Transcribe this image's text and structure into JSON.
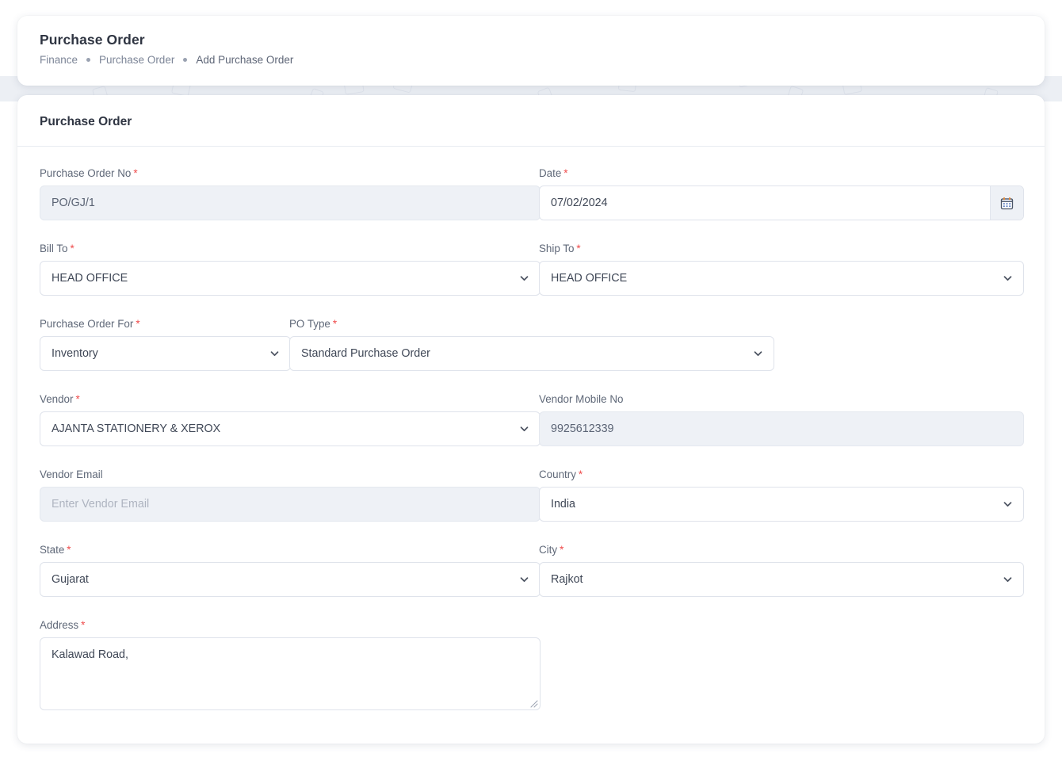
{
  "header": {
    "title": "Purchase Order",
    "breadcrumb": [
      "Finance",
      "Purchase Order",
      "Add Purchase Order"
    ]
  },
  "form_card": {
    "title": "Purchase Order"
  },
  "fields": {
    "purchase_order_no": {
      "label": "Purchase Order No",
      "required": true,
      "value": "PO/GJ/1",
      "state": "disabled"
    },
    "date": {
      "label": "Date",
      "required": true,
      "value": "07/02/2024",
      "icon": "calendar-icon",
      "icon_glyph": "🗓"
    },
    "bill_to": {
      "label": "Bill To",
      "required": true,
      "value": "HEAD OFFICE",
      "icon": "chevron-down-icon"
    },
    "ship_to": {
      "label": "Ship To",
      "required": true,
      "value": "HEAD OFFICE",
      "icon": "chevron-down-icon"
    },
    "purchase_order_for": {
      "label": "Purchase Order For",
      "required": true,
      "value": "Inventory",
      "icon": "chevron-down-icon"
    },
    "po_type": {
      "label": "PO Type",
      "required": true,
      "value": "Standard Purchase Order",
      "icon": "chevron-down-icon"
    },
    "vendor": {
      "label": "Vendor",
      "required": true,
      "value": "AJANTA STATIONERY & XEROX",
      "icon": "chevron-down-icon"
    },
    "vendor_mobile_no": {
      "label": "Vendor Mobile No",
      "required": false,
      "value": "9925612339",
      "state": "disabled"
    },
    "vendor_email": {
      "label": "Vendor Email",
      "required": false,
      "value": "",
      "placeholder": "Enter Vendor Email",
      "state": "disabled"
    },
    "country": {
      "label": "Country",
      "required": true,
      "value": "India",
      "icon": "chevron-down-icon"
    },
    "state": {
      "label": "State",
      "required": true,
      "value": "Gujarat",
      "icon": "chevron-down-icon"
    },
    "city": {
      "label": "City",
      "required": true,
      "value": "Rajkot",
      "icon": "chevron-down-icon"
    },
    "address": {
      "label": "Address",
      "required": true,
      "value": "Kalawad Road,"
    }
  },
  "colors": {
    "required_asterisk": "#ef4b4b",
    "page_background": "#ffffff",
    "pattern_strip": "#eceff4",
    "card_background": "#ffffff",
    "disabled_field": "#eef1f6",
    "border": "#dfe3eb",
    "label_text": "#5f6878",
    "value_text": "#3f4756",
    "title_text": "#2f3542",
    "breadcrumb_text": "#7c8597"
  }
}
